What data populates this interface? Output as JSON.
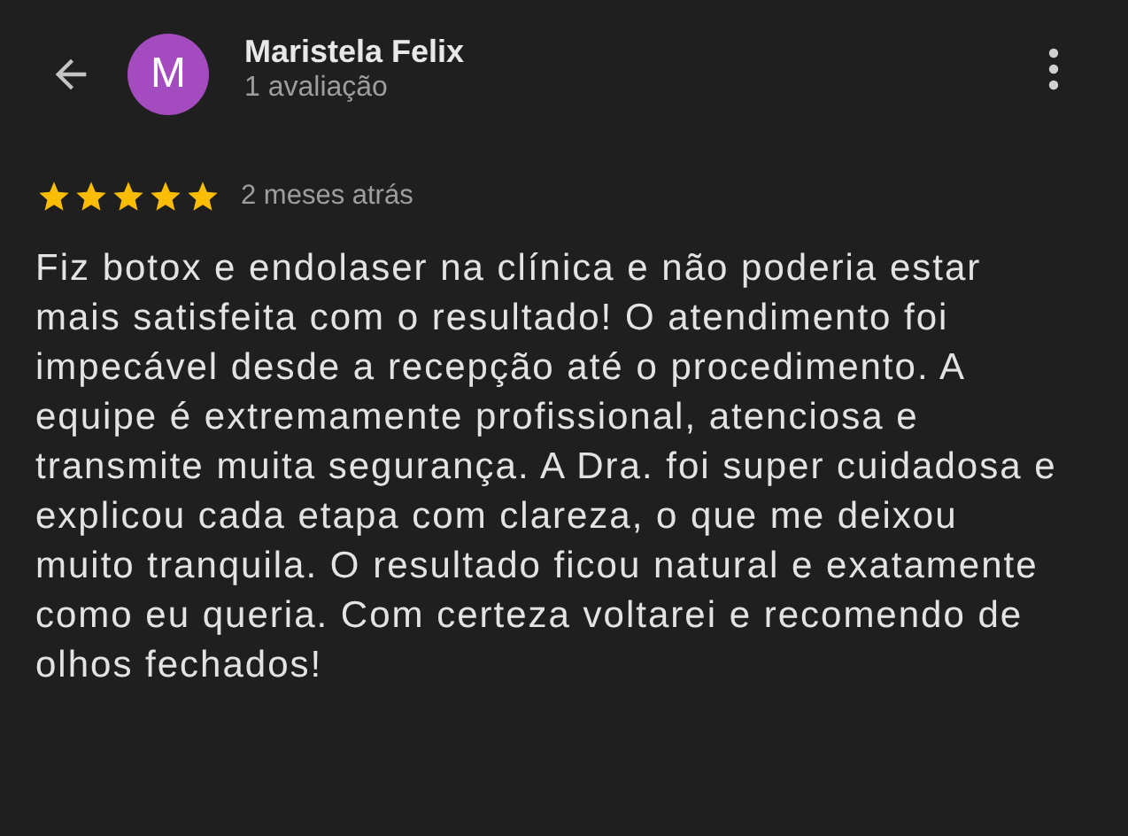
{
  "reviewer": {
    "initial": "M",
    "name": "Maristela Felix",
    "subtitle": "1 avaliação"
  },
  "review": {
    "stars": 5,
    "time": "2 meses atrás",
    "text": "Fiz botox e endolaser na clínica e não poderia estar mais satisfeita com o resultado! O atendimento foi impecável desde a recepção até o procedimento. A equipe é extremamente profissional, atenciosa e transmite muita segurança. A Dra. foi super cuidadosa e explicou cada etapa com clareza, o que me deixou muito tranquila. O resultado ficou natural e exatamente como eu queria. Com certeza voltarei e recomendo de olhos fechados!"
  }
}
